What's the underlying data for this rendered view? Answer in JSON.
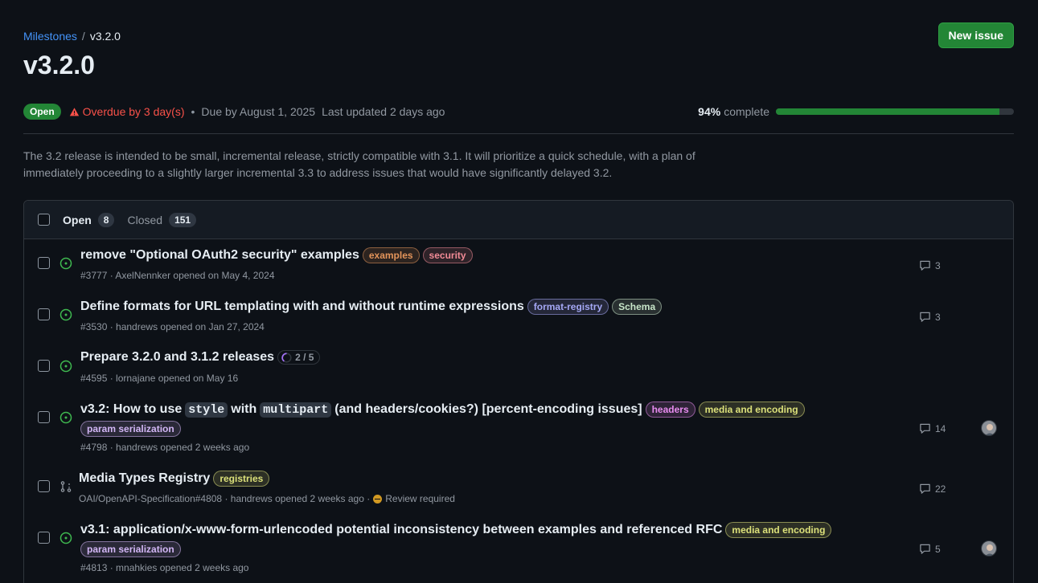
{
  "breadcrumb": {
    "parent": "Milestones",
    "separator": "/",
    "current": "v3.2.0"
  },
  "title": "v3.2.0",
  "new_issue_label": "New issue",
  "meta": {
    "state": "Open",
    "overdue": "Overdue by 3 day(s)",
    "dot": "•",
    "due": "Due by August 1, 2025",
    "updated": "Last updated 2 days ago",
    "percent": "94%",
    "percent_label": "complete",
    "progress_fraction": 0.94
  },
  "description": "The 3.2 release is intended to be small, incremental release, strictly compatible with 3.1. It will prioritize a quick schedule, with a plan of immediately proceeding to a slightly larger incremental 3.3 to address issues that would have significantly delayed 3.2.",
  "tabs": {
    "open_label": "Open",
    "open_count": "8",
    "closed_label": "Closed",
    "closed_count": "151"
  },
  "colors": {
    "accent": "#4493f8",
    "success": "#238636",
    "danger": "#f85149",
    "open_icon": "#3fb950"
  },
  "issues": [
    {
      "type": "issue",
      "title": "remove \"Optional OAuth2 security\" examples",
      "labels": [
        {
          "name": "examples",
          "color": "#e3945a"
        },
        {
          "name": "security",
          "color": "#f28b96"
        }
      ],
      "sub": "#3777 · AxelNennker opened on May 4, 2024",
      "comments": "3"
    },
    {
      "type": "issue",
      "title": "Define formats for URL templating with and without runtime expressions",
      "labels": [
        {
          "name": "format-registry",
          "color": "#a5a8f5"
        },
        {
          "name": "Schema",
          "color": "#c8e6c9"
        }
      ],
      "sub": "#3530 · handrews opened on Jan 27, 2024",
      "comments": "3"
    },
    {
      "type": "issue",
      "title": "Prepare 3.2.0 and 3.1.2 releases",
      "tasks": "2 / 5",
      "labels": [],
      "sub": "#4595 · lornajane opened on May 16"
    },
    {
      "type": "issue",
      "title_parts": [
        "v3.2: How to use",
        "style",
        "with",
        "multipart",
        "(and headers/cookies?) [percent-encoding issues]"
      ],
      "labels": [
        {
          "name": "headers",
          "color": "#e88cf0"
        },
        {
          "name": "media and encoding",
          "color": "#dbe07a"
        }
      ],
      "labels2": [
        {
          "name": "param serialization",
          "color": "#d2b6f5"
        }
      ],
      "sub": "#4798 · handrews opened 2 weeks ago",
      "comments": "14",
      "avatar": "avatar"
    },
    {
      "type": "pull",
      "title": "Media Types Registry",
      "labels": [
        {
          "name": "registries",
          "color": "#dbe07a"
        }
      ],
      "sub": "OAI/OpenAPI-Specification#4808 · handrews opened 2 weeks ago ·",
      "review": "Review required",
      "comments": "22"
    },
    {
      "type": "issue",
      "title": "v3.1: application/x-www-form-urlencoded potential inconsistency between examples and referenced RFC",
      "labels": [
        {
          "name": "media and encoding",
          "color": "#dbe07a"
        }
      ],
      "labels2": [
        {
          "name": "param serialization",
          "color": "#d2b6f5"
        }
      ],
      "sub": "#4813 · mnahkies opened 2 weeks ago",
      "comments": "5",
      "avatar": "avatar"
    }
  ]
}
